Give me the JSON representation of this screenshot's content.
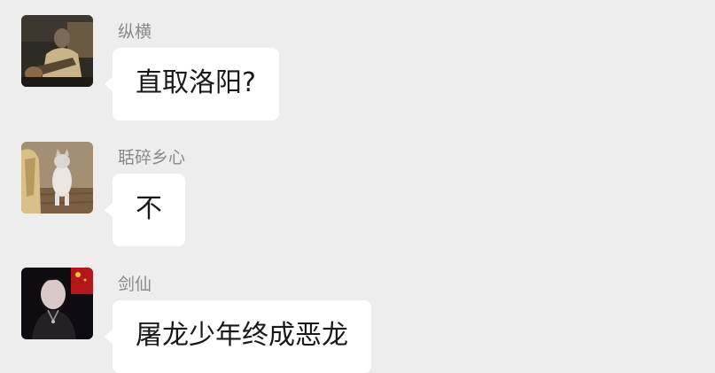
{
  "messages": [
    {
      "sender": "纵横",
      "text": "直取洛阳?",
      "avatar_icon": "man-with-guitar-photo-icon"
    },
    {
      "sender": "聒碎乡心",
      "text": "不",
      "avatar_icon": "cat-photo-icon"
    },
    {
      "sender": "剑仙",
      "text": "屠龙少年终成恶龙",
      "avatar_icon": "dark-portrait-photo-icon"
    }
  ],
  "colors": {
    "background": "#ededed",
    "bubble": "#ffffff",
    "sender_name": "#8a8a8a",
    "message_text": "#191919"
  }
}
